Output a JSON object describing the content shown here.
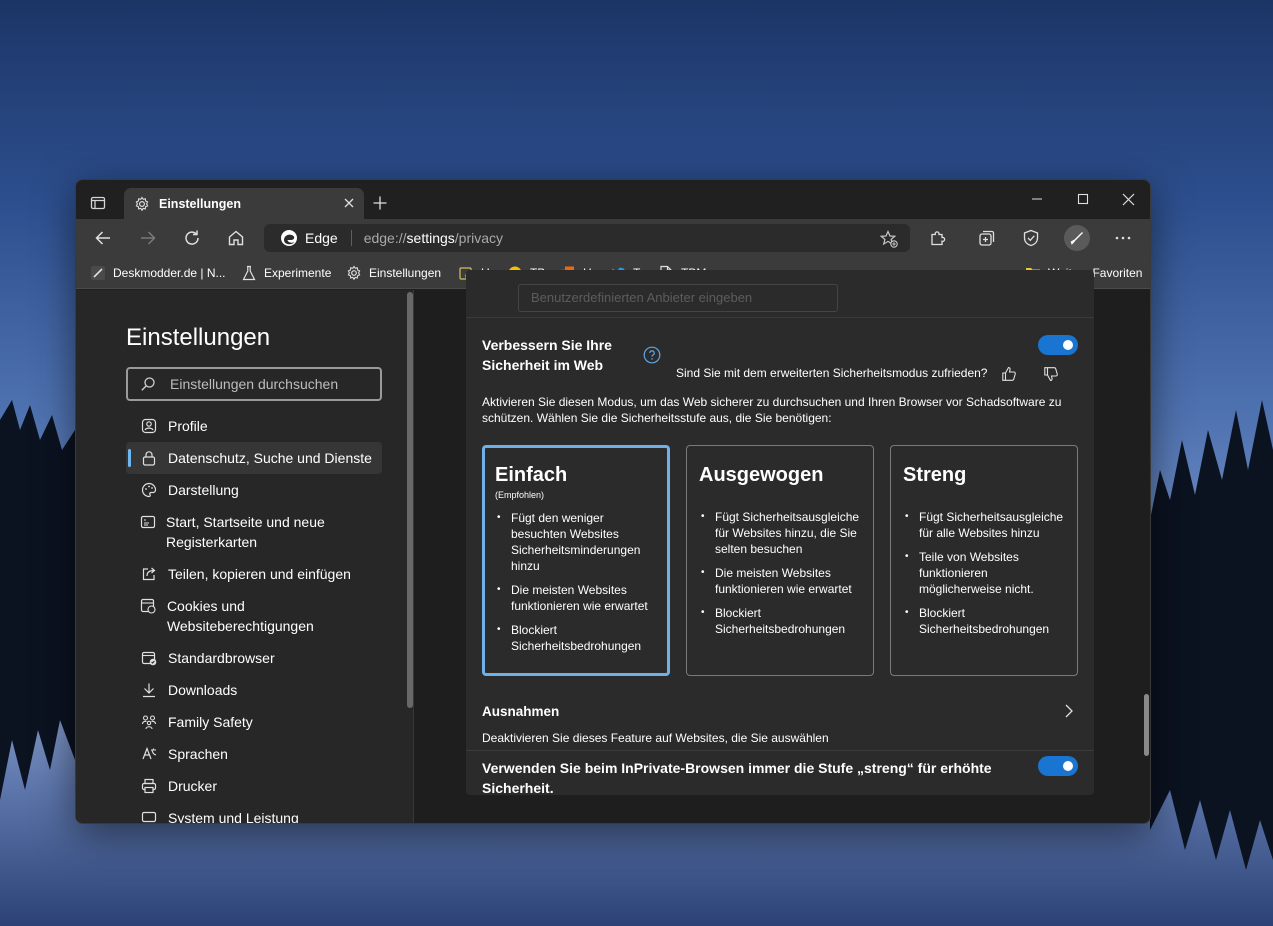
{
  "tab": {
    "title": "Einstellungen"
  },
  "address": {
    "site": "Edge",
    "url_prefix": "edge://",
    "url_host": "settings",
    "url_path": "/privacy"
  },
  "favorites": [
    {
      "icon": "deskmodder-icon",
      "label": "Deskmodder.de | N..."
    },
    {
      "icon": "flask-icon",
      "label": "Experimente"
    },
    {
      "icon": "gear-icon",
      "label": "Einstellungen"
    },
    {
      "icon": "u-favicon",
      "label": "U"
    },
    {
      "icon": "tb-favicon",
      "label": "TB"
    },
    {
      "icon": "h-favicon",
      "label": "H"
    },
    {
      "icon": "twitter-icon",
      "label": "T"
    },
    {
      "icon": "page-icon",
      "label": "TBM"
    }
  ],
  "other_favorites": "Weitere Favoriten",
  "sidebar": {
    "title": "Einstellungen",
    "search_placeholder": "Einstellungen durchsuchen",
    "items": [
      {
        "icon": "profile-icon",
        "label": "Profile",
        "active": false
      },
      {
        "icon": "lock-icon",
        "label": "Datenschutz, Suche und Dienste",
        "active": true
      },
      {
        "icon": "appearance-icon",
        "label": "Darstellung",
        "active": false
      },
      {
        "icon": "newtab-icon",
        "label": "Start, Startseite und neue Registerkarten",
        "active": false
      },
      {
        "icon": "share-icon",
        "label": "Teilen, kopieren und einfügen",
        "active": false
      },
      {
        "icon": "cookies-icon",
        "label": "Cookies und Websiteberechtigungen",
        "active": false
      },
      {
        "icon": "default-browser-icon",
        "label": "Standardbrowser",
        "active": false
      },
      {
        "icon": "download-icon",
        "label": "Downloads",
        "active": false
      },
      {
        "icon": "family-icon",
        "label": "Family Safety",
        "active": false
      },
      {
        "icon": "language-icon",
        "label": "Sprachen",
        "active": false
      },
      {
        "icon": "printer-icon",
        "label": "Drucker",
        "active": false
      },
      {
        "icon": "system-icon",
        "label": "System und Leistung",
        "active": false
      }
    ]
  },
  "main": {
    "ghost_input_placeholder": "Benutzerdefinierten Anbieter eingeben",
    "security": {
      "title": "Verbessern Sie Ihre Sicherheit im Web",
      "toggle_on": true,
      "feedback_question": "Sind Sie mit dem erweiterten Sicherheitsmodus zufrieden?",
      "description": "Aktivieren Sie diesen Modus, um das Web sicherer zu durchsuchen und Ihren Browser vor Schadsoftware zu schützen. Wählen Sie die Sicherheitsstufe aus, die Sie benötigen:",
      "levels": [
        {
          "title": "Einfach",
          "subtitle": "(Empfohlen)",
          "selected": true,
          "bullets": [
            "Fügt den weniger besuchten Websites Sicherheitsminderungen hinzu",
            "Die meisten Websites funktionieren wie erwartet",
            "Blockiert Sicherheitsbedrohungen"
          ]
        },
        {
          "title": "Ausgewogen",
          "subtitle": "",
          "selected": false,
          "bullets": [
            "Fügt Sicherheitsausgleiche für Websites hinzu, die Sie selten besuchen",
            "Die meisten Websites funktionieren wie erwartet",
            "Blockiert Sicherheitsbedrohungen"
          ]
        },
        {
          "title": "Streng",
          "subtitle": "",
          "selected": false,
          "bullets": [
            "Fügt Sicherheitsausgleiche für alle Websites hinzu",
            "Teile von Websites funktionieren möglicherweise nicht.",
            "Blockiert Sicherheitsbedrohungen"
          ]
        }
      ],
      "exceptions_title": "Ausnahmen",
      "exceptions_desc": "Deaktivieren Sie dieses Feature auf Websites, die Sie auswählen",
      "inprivate_label": "Verwenden Sie beim InPrivate-Browsen immer die Stufe „streng“ für erhöhte Sicherheit.",
      "inprivate_toggle_on": true
    }
  },
  "colors": {
    "accent": "#1a74d1",
    "selected_border": "#6fb1e6",
    "window_bg": "#202020",
    "toolbar_bg": "#3b3b3b"
  }
}
